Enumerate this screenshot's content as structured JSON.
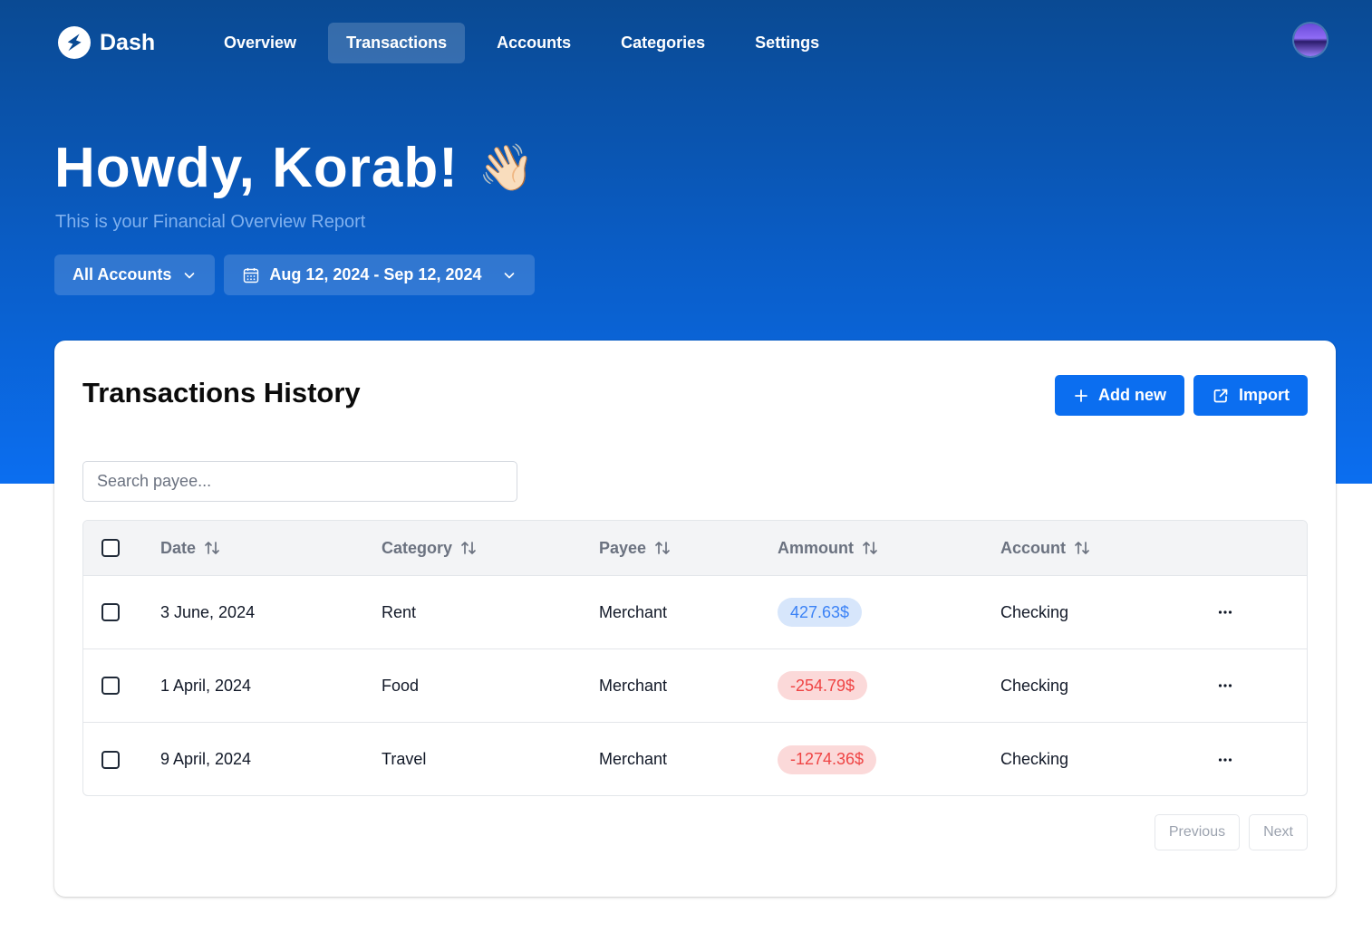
{
  "app": {
    "name": "Dash"
  },
  "nav": {
    "links": [
      {
        "label": "Overview",
        "active": false
      },
      {
        "label": "Transactions",
        "active": true
      },
      {
        "label": "Accounts",
        "active": false
      },
      {
        "label": "Categories",
        "active": false
      },
      {
        "label": "Settings",
        "active": false
      }
    ]
  },
  "header": {
    "greeting": "Howdy, Korab!",
    "wave_emoji": "👋🏻",
    "subtitle": "This is your Financial Overview Report",
    "account_filter": "All Accounts",
    "date_range": "Aug 12, 2024 - Sep 12, 2024"
  },
  "card": {
    "title": "Transactions History",
    "add_new_label": "Add new",
    "import_label": "Import",
    "search_placeholder": "Search payee...",
    "columns": [
      "Date",
      "Category",
      "Payee",
      "Ammount",
      "Account"
    ],
    "rows": [
      {
        "date": "3 June, 2024",
        "category": "Rent",
        "payee": "Merchant",
        "amount": "427.63$",
        "type": "positive",
        "account": "Checking"
      },
      {
        "date": "1 April, 2024",
        "category": "Food",
        "payee": "Merchant",
        "amount": "-254.79$",
        "type": "negative",
        "account": "Checking"
      },
      {
        "date": "9 April, 2024",
        "category": "Travel",
        "payee": "Merchant",
        "amount": "-1274.36$",
        "type": "negative",
        "account": "Checking"
      }
    ],
    "pagination": {
      "previous": "Previous",
      "next": "Next"
    }
  },
  "colors": {
    "accent": "#0b6ef0",
    "positive_bg": "#d7e6fb",
    "positive_text": "#3b82f6",
    "negative_bg": "#fbd9d9",
    "negative_text": "#ef4444"
  },
  "icons": [
    "bolt-logo-icon",
    "chevron-down-icon",
    "calendar-icon",
    "plus-icon",
    "external-link-icon",
    "sort-icon",
    "more-horizontal-icon"
  ]
}
